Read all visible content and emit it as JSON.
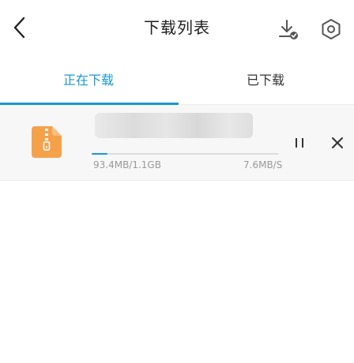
{
  "header": {
    "title": "下载列表",
    "back_icon": "chevron-left-icon",
    "download_icon": "download-done-icon",
    "settings_icon": "hexagon-settings-icon"
  },
  "tabs": [
    {
      "label": "正在下载",
      "active": true
    },
    {
      "label": "已下载",
      "active": false
    }
  ],
  "downloads": [
    {
      "file_icon": "zip-file-icon",
      "progress": 0.085,
      "size": "93.4MB/1.1GB",
      "speed": "7.6MB/S",
      "pause_icon": "pause-icon",
      "close_icon": "close-icon"
    }
  ],
  "colors": {
    "accent": "#1a97d4",
    "file_icon": "#f5a14a",
    "muted_text": "#999999",
    "row_background": "#f7f7f7"
  }
}
